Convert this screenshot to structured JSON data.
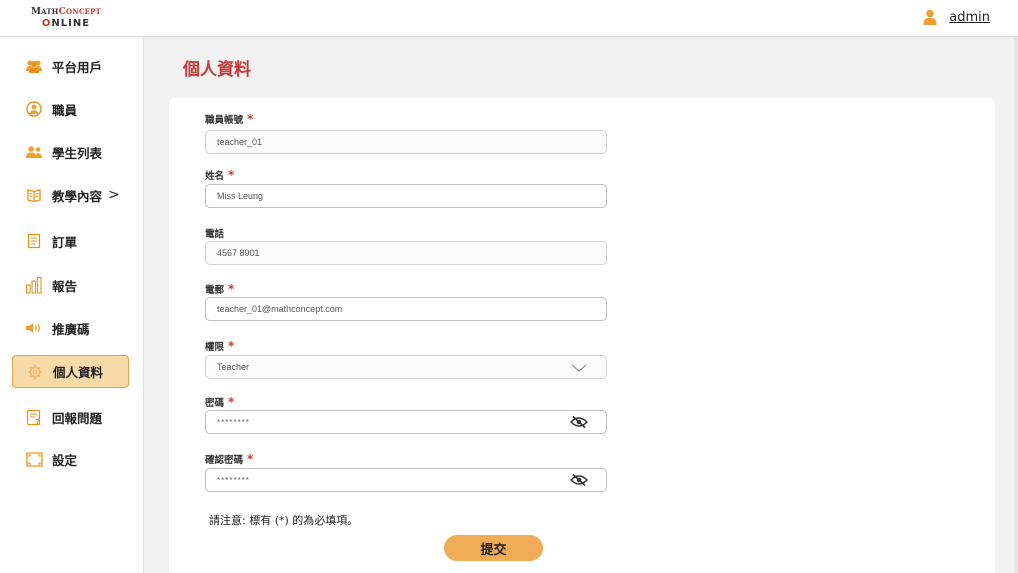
{
  "header": {
    "logo": {
      "line1_a": "M",
      "line1_b": "ATH",
      "line1_c": "C",
      "line1_d": "ONCEPT",
      "line2_o": "O",
      "line2_rest": "NLINE"
    },
    "user_name": "admin"
  },
  "sidebar": {
    "items": [
      {
        "label": "平台用戶",
        "icon": "users-group-icon"
      },
      {
        "label": "職員",
        "icon": "staff-icon"
      },
      {
        "label": "學生列表",
        "icon": "students-icon"
      },
      {
        "label": "教學內容",
        "icon": "book-icon",
        "chevron": ">"
      },
      {
        "label": "訂單",
        "icon": "order-icon"
      },
      {
        "label": "報告",
        "icon": "chart-icon"
      },
      {
        "label": "推廣碼",
        "icon": "megaphone-icon"
      },
      {
        "label": "個人資料",
        "icon": "gear-icon",
        "active": true
      },
      {
        "label": "回報問題",
        "icon": "feedback-icon"
      },
      {
        "label": "設定",
        "icon": "settings-frame-icon"
      }
    ]
  },
  "main": {
    "title": "個人資料",
    "form": {
      "staff_id": {
        "label": "職員帳號",
        "required": "*",
        "value": "teacher_01"
      },
      "name": {
        "label": "姓名",
        "required": "*",
        "value": "Miss Leung"
      },
      "phone": {
        "label": "電話",
        "value": "4567 8901"
      },
      "email": {
        "label": "電郵",
        "required": "*",
        "value": "teacher_01@mathconcept.com"
      },
      "role": {
        "label": "權限",
        "required": "*",
        "value": "Teacher"
      },
      "password": {
        "label": "密碼",
        "required": "*",
        "value": "********"
      },
      "confirm_password": {
        "label": "確認密碼",
        "required": "*",
        "value": "********"
      }
    },
    "note": "請注意: 標有 (*) 的為必填項。",
    "submit_label": "提交"
  },
  "colors": {
    "accent": "#c33a37",
    "button": "#f1ac57",
    "active_bg": "#f8d9a8",
    "icon_orange": "#f0a030"
  }
}
